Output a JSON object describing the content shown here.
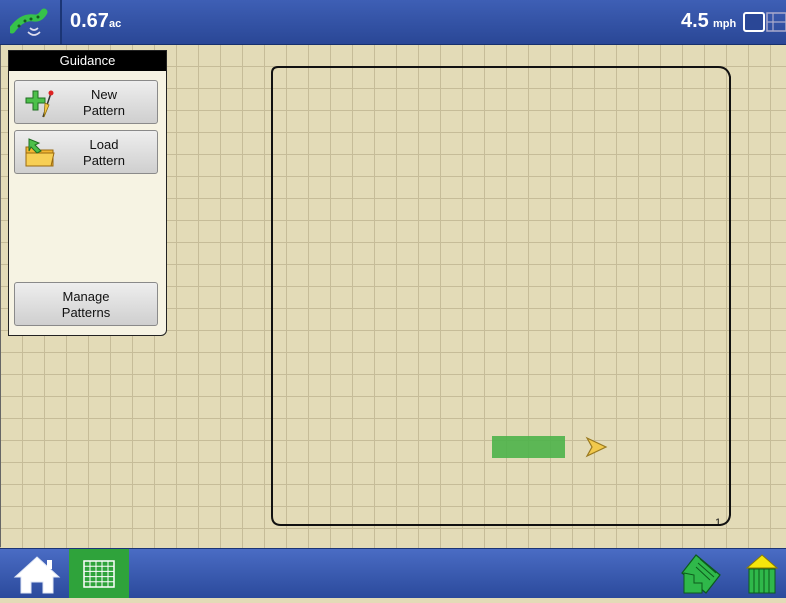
{
  "topbar": {
    "area_value": "0.67",
    "area_unit": "ac",
    "speed_value": "4.5",
    "speed_unit": "mph",
    "gps_icon": "gps-satellite-icon",
    "view_icon": "map-view-toggle-icon"
  },
  "panel": {
    "title": "Guidance",
    "new_pattern": {
      "line1": "New",
      "line2": "Pattern",
      "icon": "new-pattern-icon"
    },
    "load_pattern": {
      "line1": "Load",
      "line2": "Pattern",
      "icon": "folder-icon"
    },
    "manage_patterns": {
      "line1": "Manage",
      "line2": "Patterns"
    }
  },
  "map": {
    "boundary_label": "1",
    "coverage_color": "#4db34a",
    "vehicle_icon": "vehicle-arrow-icon"
  },
  "bottombar": {
    "home_icon": "home-icon",
    "map_icon": "grid-map-icon",
    "layers_icon": "field-layers-icon",
    "bin_icon": "grain-bin-icon"
  },
  "colors": {
    "header_blue": "#2a4796",
    "map_background": "#e3dbb7",
    "active_tab_green": "#2fa33b"
  }
}
